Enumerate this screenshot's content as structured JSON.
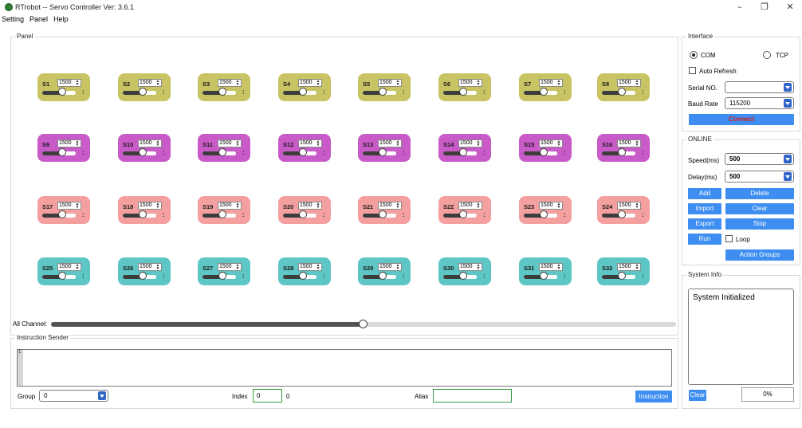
{
  "window": {
    "title": "RTrobot -- Servo Controller  Ver: 3.6.1",
    "controls": [
      "–",
      "❐",
      "✕"
    ]
  },
  "menu": [
    "Setting",
    "Panel",
    "Help"
  ],
  "panel": {
    "title": "Panel",
    "colors": {
      "yellow": "#c8c464",
      "purple": "#c95bc9",
      "pink": "#f4a0a0",
      "teal": "#5fc6c6"
    },
    "slider_fraction": 0.6,
    "servos": [
      {
        "label": "S1",
        "value": "1500"
      },
      {
        "label": "S2",
        "value": "1500"
      },
      {
        "label": "S3",
        "value": "1500"
      },
      {
        "label": "S4",
        "value": "1500"
      },
      {
        "label": "S5",
        "value": "1500"
      },
      {
        "label": "S6",
        "value": "1500"
      },
      {
        "label": "S7",
        "value": "1500"
      },
      {
        "label": "S8",
        "value": "1500"
      },
      {
        "label": "S9",
        "value": "1500"
      },
      {
        "label": "S10",
        "value": "1500"
      },
      {
        "label": "S11",
        "value": "1500"
      },
      {
        "label": "S12",
        "value": "1500"
      },
      {
        "label": "S13",
        "value": "1500"
      },
      {
        "label": "S14",
        "value": "1500"
      },
      {
        "label": "S15",
        "value": "1500"
      },
      {
        "label": "S16",
        "value": "1500"
      },
      {
        "label": "S17",
        "value": "1500"
      },
      {
        "label": "S18",
        "value": "1500"
      },
      {
        "label": "S19",
        "value": "1500"
      },
      {
        "label": "S20",
        "value": "1500"
      },
      {
        "label": "S21",
        "value": "1500"
      },
      {
        "label": "S22",
        "value": "1500"
      },
      {
        "label": "S23",
        "value": "1500"
      },
      {
        "label": "S24",
        "value": "1500"
      },
      {
        "label": "S25",
        "value": "1500"
      },
      {
        "label": "S26",
        "value": "1500"
      },
      {
        "label": "S27",
        "value": "1500"
      },
      {
        "label": "S28",
        "value": "1500"
      },
      {
        "label": "S29",
        "value": "1500"
      },
      {
        "label": "S30",
        "value": "1500"
      },
      {
        "label": "S31",
        "value": "1500"
      },
      {
        "label": "S32",
        "value": "1500"
      }
    ]
  },
  "all_channel": {
    "label": "All Channel:",
    "fraction": 0.5
  },
  "instruction_sender": {
    "title": "Instruction Sender",
    "line_number": "1",
    "group_label": "Group",
    "group_value": "0",
    "index_label": "Index",
    "index_value": "0",
    "index_count": "0",
    "alias_label": "Alias",
    "alias_value": "",
    "instruction_button": "Instruction"
  },
  "interface": {
    "title": "Interface",
    "com_label": "COM",
    "tcp_label": "TCP",
    "selected": "COM",
    "auto_refresh_label": "Auto Refresh",
    "serial_label": "Serial NO.",
    "serial_value": "",
    "baud_label": "Baud Rate",
    "baud_value": "115200",
    "connect_label": "Connect"
  },
  "online": {
    "title": "ONLINE",
    "speed_label": "Speed(ms)",
    "speed_value": "500",
    "delay_label": "Delay(ms)",
    "delay_value": "500",
    "add": "Add",
    "delete": "Delete",
    "import": "Import",
    "clear": "Clear",
    "export": "Export",
    "stop": "Stop",
    "run": "Run",
    "loop_label": "Loop",
    "action_groups": "Action Groups"
  },
  "system_info": {
    "title": "System Info",
    "message": "System Initialized",
    "clear": "Clear",
    "progress": "0%"
  }
}
